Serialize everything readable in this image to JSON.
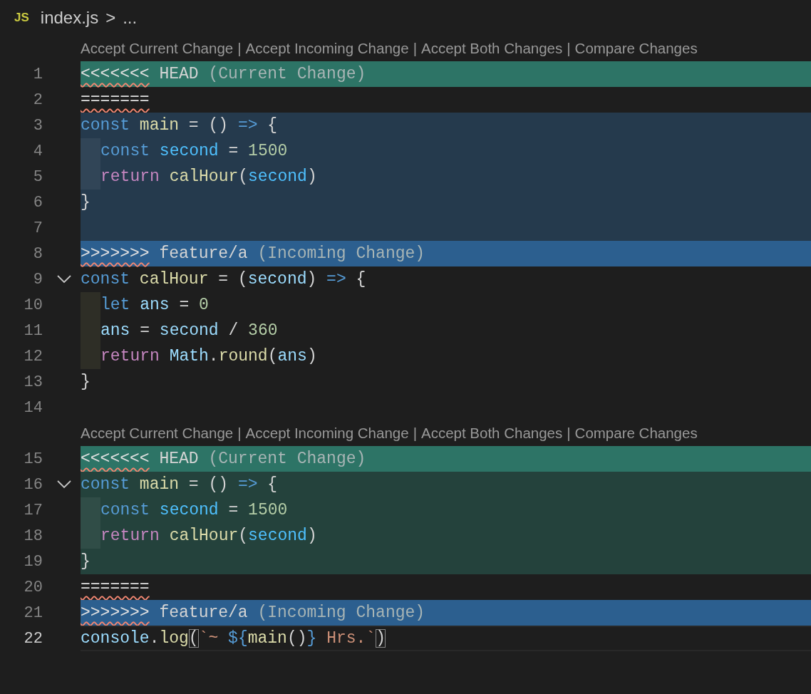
{
  "breadcrumb": {
    "file": "index.js",
    "badge": "JS",
    "separator": ">",
    "more": "..."
  },
  "lines": [
    {
      "kind": "codelens",
      "actions": [
        "Accept Current Change",
        "Accept Incoming Change",
        "Accept Both Changes",
        "Compare Changes"
      ],
      "separator": "|"
    },
    {
      "kind": "code",
      "number": "1",
      "color": "#2d7466",
      "tokens": [
        {
          "t": "<<<<<<<",
          "color": "#e0e0e0",
          "squiggle": true
        },
        {
          "t": " HEAD ",
          "color": "#d4d4d4"
        },
        {
          "t": "(Current Change)",
          "color": "#a8b5b5"
        }
      ]
    },
    {
      "kind": "code",
      "number": "2",
      "tokens": [
        {
          "t": "=======",
          "color": "#e0e0e0",
          "squiggle": true
        }
      ]
    },
    {
      "kind": "code",
      "number": "3",
      "color": "#253a4d",
      "tokens": [
        {
          "t": "const ",
          "color": "#569cd6"
        },
        {
          "t": "main",
          "color": "#dcdcaa"
        },
        {
          "t": " = () ",
          "color": "#d4d4d4"
        },
        {
          "t": "=>",
          "color": "#569cd6"
        },
        {
          "t": " {",
          "color": "#d4d4d4"
        }
      ]
    },
    {
      "kind": "code",
      "number": "4",
      "color": "#253a4d",
      "indented": true,
      "tokens": [
        {
          "t": "const ",
          "color": "#569cd6"
        },
        {
          "t": "second",
          "color": "#4fc1ff"
        },
        {
          "t": " = ",
          "color": "#d4d4d4"
        },
        {
          "t": "1500",
          "color": "#b5cea8"
        }
      ]
    },
    {
      "kind": "code",
      "number": "5",
      "color": "#253a4d",
      "indented": true,
      "tokens": [
        {
          "t": "return ",
          "color": "#c586c0"
        },
        {
          "t": "calHour",
          "color": "#dcdcaa"
        },
        {
          "t": "(",
          "color": "#d4d4d4"
        },
        {
          "t": "second",
          "color": "#4fc1ff"
        },
        {
          "t": ")",
          "color": "#d4d4d4"
        }
      ]
    },
    {
      "kind": "code",
      "number": "6",
      "color": "#253a4d",
      "tokens": [
        {
          "t": "}",
          "color": "#d4d4d4"
        }
      ]
    },
    {
      "kind": "code",
      "number": "7",
      "color": "#253a4d"
    },
    {
      "kind": "code",
      "number": "8",
      "color": "#2c5f8f",
      "tokens": [
        {
          "t": ">>>>>>>",
          "color": "#e0e0e0",
          "squiggle": true
        },
        {
          "t": " feature/a ",
          "color": "#d4d4d4"
        },
        {
          "t": "(Incoming Change)",
          "color": "#a8b5b5"
        }
      ]
    },
    {
      "kind": "code",
      "number": "9",
      "expanded": true,
      "tokens": [
        {
          "t": "const ",
          "color": "#569cd6"
        },
        {
          "t": "calHour",
          "color": "#dcdcaa"
        },
        {
          "t": " = (",
          "color": "#d4d4d4"
        },
        {
          "t": "second",
          "color": "#9cdcfe"
        },
        {
          "t": ") ",
          "color": "#d4d4d4"
        },
        {
          "t": "=>",
          "color": "#569cd6"
        },
        {
          "t": " {",
          "color": "#d4d4d4"
        }
      ]
    },
    {
      "kind": "code",
      "number": "10",
      "indented": true,
      "tokens": [
        {
          "t": "let ",
          "color": "#569cd6"
        },
        {
          "t": "ans",
          "color": "#9cdcfe"
        },
        {
          "t": " = ",
          "color": "#d4d4d4"
        },
        {
          "t": "0",
          "color": "#b5cea8"
        }
      ]
    },
    {
      "kind": "code",
      "number": "11",
      "indented": true,
      "tokens": [
        {
          "t": "ans",
          "color": "#9cdcfe"
        },
        {
          "t": " = ",
          "color": "#d4d4d4"
        },
        {
          "t": "second",
          "color": "#9cdcfe"
        },
        {
          "t": " / ",
          "color": "#d4d4d4"
        },
        {
          "t": "360",
          "color": "#b5cea8"
        }
      ]
    },
    {
      "kind": "code",
      "number": "12",
      "indented": true,
      "tokens": [
        {
          "t": "return ",
          "color": "#c586c0"
        },
        {
          "t": "Math",
          "color": "#9cdcfe"
        },
        {
          "t": ".",
          "color": "#d4d4d4"
        },
        {
          "t": "round",
          "color": "#dcdcaa"
        },
        {
          "t": "(",
          "color": "#d4d4d4"
        },
        {
          "t": "ans",
          "color": "#9cdcfe"
        },
        {
          "t": ")",
          "color": "#d4d4d4"
        }
      ]
    },
    {
      "kind": "code",
      "number": "13",
      "tokens": [
        {
          "t": "}",
          "color": "#d4d4d4"
        }
      ]
    },
    {
      "kind": "code",
      "number": "14"
    },
    {
      "kind": "codelens",
      "actions": [
        "Accept Current Change",
        "Accept Incoming Change",
        "Accept Both Changes",
        "Compare Changes"
      ],
      "separator": "|"
    },
    {
      "kind": "code",
      "number": "15",
      "color": "#2d7466",
      "tokens": [
        {
          "t": "<<<<<<<",
          "color": "#e0e0e0",
          "squiggle": true
        },
        {
          "t": " HEAD ",
          "color": "#d4d4d4"
        },
        {
          "t": "(Current Change)",
          "color": "#a8b5b5"
        }
      ]
    },
    {
      "kind": "code",
      "number": "16",
      "color": "#24423c",
      "expanded": true,
      "tokens": [
        {
          "t": "const ",
          "color": "#569cd6"
        },
        {
          "t": "main",
          "color": "#dcdcaa"
        },
        {
          "t": " = () ",
          "color": "#d4d4d4"
        },
        {
          "t": "=>",
          "color": "#569cd6"
        },
        {
          "t": " {",
          "color": "#d4d4d4"
        }
      ]
    },
    {
      "kind": "code",
      "number": "17",
      "color": "#24423c",
      "indented": true,
      "tokens": [
        {
          "t": "const ",
          "color": "#569cd6"
        },
        {
          "t": "second",
          "color": "#4fc1ff"
        },
        {
          "t": " = ",
          "color": "#d4d4d4"
        },
        {
          "t": "1500",
          "color": "#b5cea8"
        }
      ]
    },
    {
      "kind": "code",
      "number": "18",
      "color": "#24423c",
      "indented": true,
      "tokens": [
        {
          "t": "return ",
          "color": "#c586c0"
        },
        {
          "t": "calHour",
          "color": "#dcdcaa"
        },
        {
          "t": "(",
          "color": "#d4d4d4"
        },
        {
          "t": "second",
          "color": "#4fc1ff"
        },
        {
          "t": ")",
          "color": "#d4d4d4"
        }
      ]
    },
    {
      "kind": "code",
      "number": "19",
      "color": "#24423c",
      "tokens": [
        {
          "t": "}",
          "color": "#d4d4d4"
        }
      ]
    },
    {
      "kind": "code",
      "number": "20",
      "tokens": [
        {
          "t": "=======",
          "color": "#e0e0e0",
          "squiggle": true
        }
      ]
    },
    {
      "kind": "code",
      "number": "21",
      "color": "#2c5f8f",
      "tokens": [
        {
          "t": ">>>>>>>",
          "color": "#e0e0e0",
          "squiggle": true
        },
        {
          "t": " feature/a ",
          "color": "#d4d4d4"
        },
        {
          "t": "(Incoming Change)",
          "color": "#a8b5b5"
        }
      ]
    },
    {
      "kind": "code",
      "number": "22",
      "active": true,
      "tokens": [
        {
          "t": "console",
          "color": "#9cdcfe"
        },
        {
          "t": ".",
          "color": "#d4d4d4"
        },
        {
          "t": "log",
          "color": "#dcdcaa"
        },
        {
          "t": "(",
          "color": "#d4d4d4",
          "bracket": true
        },
        {
          "t": "`~ ",
          "color": "#ce9178"
        },
        {
          "t": "${",
          "color": "#569cd6"
        },
        {
          "t": "main",
          "color": "#dcdcaa"
        },
        {
          "t": "()",
          "color": "#d4d4d4"
        },
        {
          "t": "}",
          "color": "#569cd6"
        },
        {
          "t": " Hrs.`",
          "color": "#ce9178"
        },
        {
          "t": ")",
          "color": "#d4d4d4",
          "bracket": true
        }
      ]
    }
  ]
}
